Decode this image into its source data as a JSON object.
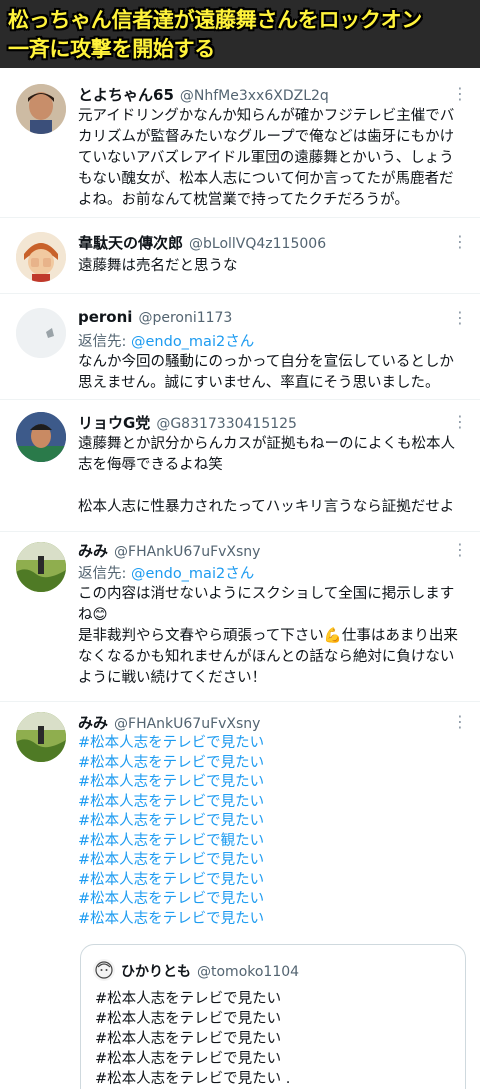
{
  "banner": {
    "line1": "松っちゃん信者達が遠藤舞さんをロックオン",
    "line2": "一斉に攻撃を開始する"
  },
  "tweets": [
    {
      "name": "とよちゃん65",
      "handle": "@NhfMe3xx6XDZL2q",
      "body": "元アイドリングかなんか知らんが確かフジテレビ主催でバカリズムが監督みたいなグループで俺などは歯牙にもかけていないアバズレアイドル軍団の遠藤舞とかいう、しょうもない醜女が、松本人志について何か言ってたが馬鹿者だよね。お前なんて枕営業で持ってたクチだろうが。"
    },
    {
      "name": "韋駄天の傳次郎",
      "handle": "@bLollVQ4z115006",
      "body": "遠藤舞は売名だと思うな"
    },
    {
      "name": "peroni",
      "handle": "@peroni1173",
      "reply_label": "返信先: ",
      "reply_to": "@endo_mai2さん",
      "body": "なんか今回の騒動にのっかって自分を宣伝しているとしか思えません。誠にすいません、率直にそう思いました。"
    },
    {
      "name": "リョウG党",
      "handle": "@G8317330415125",
      "body": "遠藤舞とか訳分からんカスが証拠もねーのによくも松本人志を侮辱できるよね笑\n\n松本人志に性暴力されたってハッキリ言うなら証拠だせよ"
    },
    {
      "name": "みみ",
      "handle": "@FHAnkU67uFvXsny",
      "reply_label": "返信先: ",
      "reply_to": "@endo_mai2さん",
      "body": "この内容は消せないようにスクショして全国に掲示しますね😊\n是非裁判やら文春やら頑張って下さい💪仕事はあまり出来なくなるかも知れませんがほんとの話なら絶対に負けないように戦い続けてください！"
    },
    {
      "name": "みみ",
      "handle": "@FHAnkU67uFvXsny",
      "hashtags": [
        "#松本人志をテレビで見たい",
        "#松本人志をテレビで見たい",
        "#松本人志をテレビで見たい",
        "#松本人志をテレビで見たい",
        "#松本人志をテレビで見たい",
        "#松本人志をテレビで観たい",
        "#松本人志をテレビで見たい",
        "#松本人志をテレビで見たい",
        "#松本人志をテレビで見たい",
        "#松本人志をテレビで見たい"
      ]
    }
  ],
  "quote": {
    "name": "ひかりとも",
    "handle": "@tomoko1104",
    "lines": [
      "#松本人志をテレビで見たい",
      " #松本人志をテレビで見たい",
      " #松本人志をテレビで見たい",
      " #松本人志をテレビで見たい",
      " #松本人志をテレビで見たい ."
    ]
  },
  "icons": {
    "more": "more-vertical-icon"
  },
  "colors": {
    "banner_text": "#fff33b",
    "banner_bg": "#2a2a2a",
    "link": "#1d9bf0",
    "secondary_text": "#536471"
  }
}
